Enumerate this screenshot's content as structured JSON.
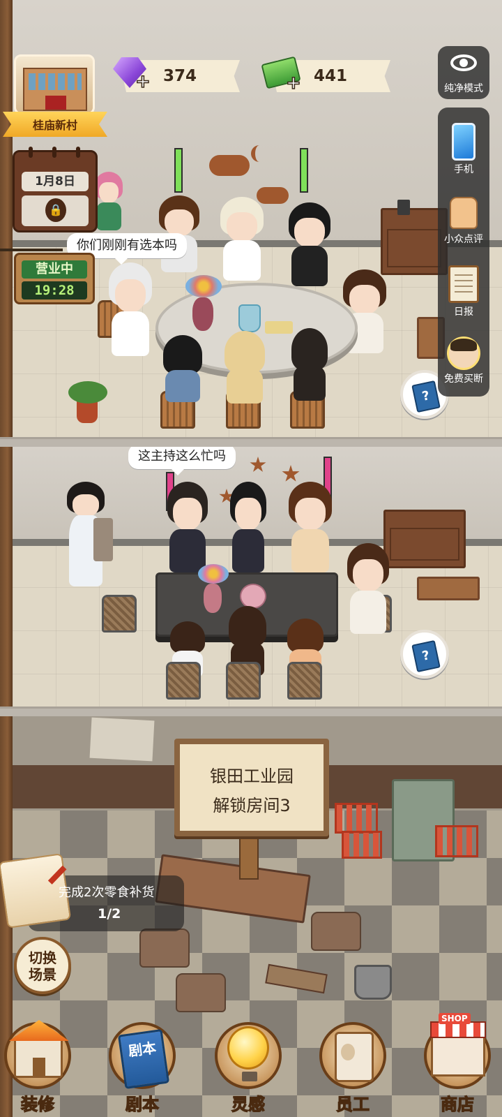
{
  "location": {
    "name": "桂庙新村"
  },
  "resources": {
    "gems": "374",
    "cash": "441",
    "plus_glyph": "+"
  },
  "calendar": {
    "date": "1月8日",
    "lock_glyph": "🔒"
  },
  "business": {
    "status": "营业中",
    "time": "19:28"
  },
  "side_menu": {
    "pure_mode": "纯净模式",
    "items": [
      {
        "label": "手机",
        "icon": "phone-icon"
      },
      {
        "label": "小众点评",
        "icon": "thumbs-up-icon"
      },
      {
        "label": "日报",
        "icon": "clipboard-icon"
      },
      {
        "label": "免费买断",
        "icon": "avatar-icon"
      }
    ]
  },
  "book_glyph": "?",
  "speech": {
    "room1": "你们刚刚有选本吗",
    "room2": "这主持这么忙吗"
  },
  "locked_room": {
    "line1": "银田工业园",
    "line2": "解锁房间3"
  },
  "quest": {
    "title": "完成2次零食补货",
    "progress": "1/2"
  },
  "switch_scene": {
    "line1": "切换",
    "line2": "场景"
  },
  "bottom_nav": {
    "items": [
      {
        "label": "装修",
        "icon": "house-icon"
      },
      {
        "label": "剧本",
        "icon": "script-book-icon",
        "icon_text": "剧本"
      },
      {
        "label": "灵感",
        "icon": "lightbulb-icon"
      },
      {
        "label": "员工",
        "icon": "staff-badge-icon"
      },
      {
        "label": "商店",
        "icon": "shop-icon",
        "icon_text": "SHOP"
      }
    ]
  },
  "colors": {
    "ribbon": "#f0a826",
    "open_status_bg": "#2f7a3a",
    "clock_text": "#b6f07a",
    "side_panel_bg": "#2d2d2d"
  }
}
